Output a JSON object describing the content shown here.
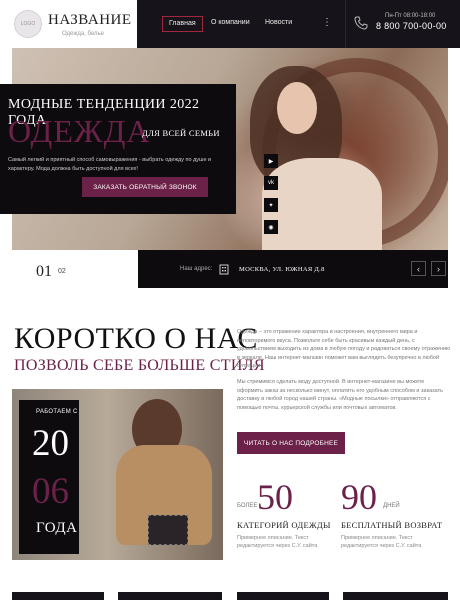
{
  "header": {
    "logo_text": "LOGO",
    "brand": "НАЗВАНИЕ",
    "brand_sub": "Одежда, белье",
    "nav": [
      {
        "label": "Главная",
        "active": true
      },
      {
        "label": "О компании",
        "active": false
      },
      {
        "label": "Новости",
        "active": false
      }
    ],
    "menu_icon": "⋮",
    "hours": "Пн-Пт 08:00-18:00",
    "phone": "8 800 700-00-00"
  },
  "hero": {
    "title_line1": "МОДНЫЕ ТЕНДЕНЦИИ 2022 ГОДА",
    "title_big": "ОДЕЖДА",
    "title_line3": "ДЛЯ ВСЕЙ СЕМЬИ",
    "description": "Самый легкий и приятный способ самовыражения - выбрать одежду по душе и характеру. Мода должна быть доступной для всех!",
    "button": "ЗАКАЗАТЬ ОБРАТНЫЙ ЗВОНОК",
    "social": [
      "youtube-icon",
      "vk-icon",
      "twitter-icon",
      "eye-icon"
    ]
  },
  "slider": {
    "current": "01",
    "next": "02",
    "address_label": "Наш адрес:",
    "address": "МОСКВА, УЛ. ЮЖНАЯ Д.8",
    "prev_arrow": "‹",
    "next_arrow": "›"
  },
  "about": {
    "heading": "КОРОТКО О НАС",
    "subheading": "ПОЗВОЛЬ СЕБЕ БОЛЬШЕ СТИЛЯ",
    "paragraph1": "Одежда – это отражение характера и настроения, внутреннего мира и неповторимого вкуса. Позвольте себе быть красивым каждый день, с удовольствием выходить из дома в любую погоду и радоваться своему отражению в зеркале. Наш интернет-магазин поможет вам выглядеть безупречно в любой ситуации.",
    "paragraph2": "Мы стремимся сделать моду доступной. В интернет-магазине вы можете оформить заказ за несколько минут, оплатить его удобным способом и заказать доставку в любой город нашей страны. «Модные посылки» отправляются с помощью почты, курьерской службы или почтовых автоматов.",
    "years_label": "РАБОТАЕМ С",
    "years_num1": "20",
    "years_num2": "06",
    "years_word": "ГОДА",
    "button": "ЧИТАТЬ О НАС ПОДРОБНЕЕ"
  },
  "stats": [
    {
      "prefix": "БОЛЕЕ",
      "number": "50",
      "suffix": "",
      "title": "КАТЕГОРИЙ ОДЕЖДЫ",
      "desc": "Примерное описание. Текст редактируется через С.У. сайта"
    },
    {
      "prefix": "",
      "number": "90",
      "suffix": "ДНЕЙ",
      "title": "БЕСПЛАТНЫЙ ВОЗВРАТ",
      "desc": "Примерное описание. Текст редактируется через С.У. сайта"
    }
  ]
}
